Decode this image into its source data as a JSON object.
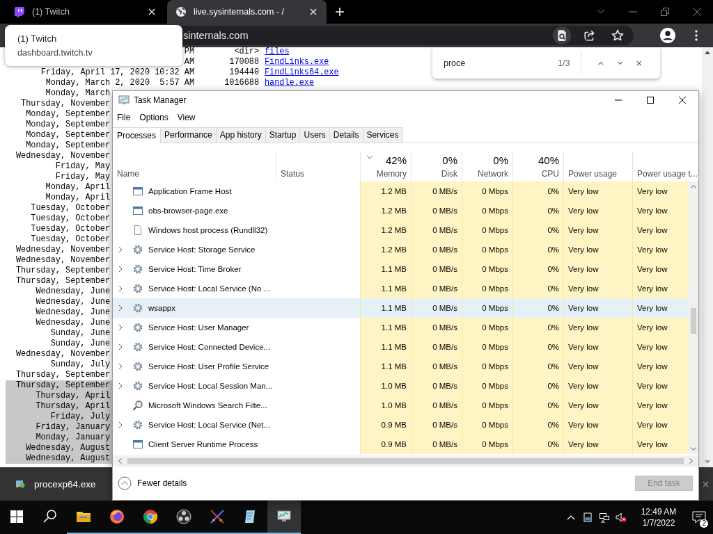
{
  "browser": {
    "tabs": [
      {
        "title": "(1) Twitch",
        "kind": "twitch",
        "selected": false
      },
      {
        "title": "live.sysinternals.com - /",
        "kind": "globe",
        "selected": true
      }
    ],
    "address": "sinternals.com",
    "tab_tooltip": {
      "title": "(1) Twitch",
      "url": "dashboard.twitch.tv"
    },
    "find_bar": {
      "query": "proce",
      "count": "1/3"
    },
    "listing": [
      {
        "time": "PM",
        "size": "<dir>",
        "name": "files",
        "selected": false
      },
      {
        "time": "AM",
        "size": "170088",
        "name": "FindLinks.exe",
        "selected": false
      },
      {
        "date": "Friday, April 17, 2020",
        "time": "10:32 AM",
        "size": "194440",
        "name": "FindLinks64.exe",
        "selected": false
      },
      {
        "date": "Monday, March 2, 2020",
        "time": "5:57 AM",
        "size": "1016688",
        "name": "handle.exe",
        "selected": false
      },
      {
        "date": "Monday, March",
        "selected": false
      },
      {
        "date": "Thursday, November",
        "selected": false
      },
      {
        "date": "Monday, September",
        "selected": false
      },
      {
        "date": "Monday, September",
        "selected": false
      },
      {
        "date": "Monday, September",
        "selected": false
      },
      {
        "date": "Monday, September",
        "selected": false
      },
      {
        "date": "Wednesday, November",
        "selected": false
      },
      {
        "date": "Friday, May",
        "selected": false
      },
      {
        "date": "Friday, May",
        "selected": false
      },
      {
        "date": "Monday, April",
        "selected": false
      },
      {
        "date": "Monday, April",
        "selected": false
      },
      {
        "date": "Tuesday, October",
        "selected": false
      },
      {
        "date": "Tuesday, October",
        "selected": false
      },
      {
        "date": "Tuesday, October",
        "selected": false
      },
      {
        "date": "Tuesday, October",
        "selected": false
      },
      {
        "date": "Wednesday, November",
        "selected": false
      },
      {
        "date": "Wednesday, November",
        "selected": false
      },
      {
        "date": "Thursday, September",
        "selected": false
      },
      {
        "date": "Thursday, September",
        "selected": false
      },
      {
        "date": "Wednesday, June",
        "selected": false
      },
      {
        "date": "Wednesday, June",
        "selected": false
      },
      {
        "date": "Wednesday, June",
        "selected": false
      },
      {
        "date": "Wednesday, June",
        "selected": false
      },
      {
        "date": "Sunday, June",
        "selected": false
      },
      {
        "date": "Sunday, June",
        "selected": false
      },
      {
        "date": "Wednesday, November",
        "selected": false
      },
      {
        "date": "Sunday, July",
        "selected": false
      },
      {
        "date": "Thursday, September",
        "selected": false
      },
      {
        "date": "Thursday, September",
        "selected": true
      },
      {
        "date": "Thursday, April",
        "selected": true
      },
      {
        "date": "Thursday, April",
        "selected": true
      },
      {
        "date": "Friday, July",
        "selected": true
      },
      {
        "date": "Friday, January",
        "selected": true
      },
      {
        "date": "Monday, January",
        "selected": true
      },
      {
        "date": "Wednesday, August",
        "selected": true
      },
      {
        "date": "Wednesday, August",
        "selected": true
      }
    ],
    "download": {
      "file": "procexp64.exe"
    }
  },
  "task_manager": {
    "title": "Task Manager",
    "menu": [
      "File",
      "Options",
      "View"
    ],
    "tabs": [
      {
        "label": "Processes",
        "selected": true
      },
      {
        "label": "Performance",
        "selected": false
      },
      {
        "label": "App history",
        "selected": false
      },
      {
        "label": "Startup",
        "selected": false
      },
      {
        "label": "Users",
        "selected": false
      },
      {
        "label": "Details",
        "selected": false
      },
      {
        "label": "Services",
        "selected": false
      }
    ],
    "columns": [
      {
        "label": "Name",
        "kind": "text"
      },
      {
        "label": "Status",
        "kind": "text"
      },
      {
        "label": "Memory",
        "percent": "42%",
        "sorted": true,
        "kind": "number"
      },
      {
        "label": "Disk",
        "percent": "0%",
        "sorted": false,
        "kind": "number"
      },
      {
        "label": "Network",
        "percent": "0%",
        "sorted": false,
        "kind": "number"
      },
      {
        "label": "CPU",
        "percent": "40%",
        "sorted": false,
        "kind": "number"
      },
      {
        "label": "Power usage",
        "kind": "rating"
      },
      {
        "label": "Power usage t...",
        "kind": "rating"
      }
    ],
    "processes": [
      {
        "name": "Application Frame Host",
        "kind": "app",
        "expandable": false,
        "selected": false,
        "memory": "1.2 MB",
        "disk": "0 MB/s",
        "network": "0 Mbps",
        "cpu": "0%",
        "power": "Very low",
        "power_trend": "Very low"
      },
      {
        "name": "obs-browser-page.exe",
        "kind": "app",
        "expandable": false,
        "selected": false,
        "memory": "1.2 MB",
        "disk": "0 MB/s",
        "network": "0 Mbps",
        "cpu": "0%",
        "power": "Very low",
        "power_trend": "Very low"
      },
      {
        "name": "Windows host process (Rundll32)",
        "kind": "document",
        "expandable": false,
        "selected": false,
        "memory": "1.2 MB",
        "disk": "0 MB/s",
        "network": "0 Mbps",
        "cpu": "0%",
        "power": "Very low",
        "power_trend": "Very low"
      },
      {
        "name": "Service Host: Storage Service",
        "kind": "service",
        "expandable": true,
        "selected": false,
        "memory": "1.2 MB",
        "disk": "0 MB/s",
        "network": "0 Mbps",
        "cpu": "0%",
        "power": "Very low",
        "power_trend": "Very low"
      },
      {
        "name": "Service Host: Time Broker",
        "kind": "service",
        "expandable": true,
        "selected": false,
        "memory": "1.1 MB",
        "disk": "0 MB/s",
        "network": "0 Mbps",
        "cpu": "0%",
        "power": "Very low",
        "power_trend": "Very low"
      },
      {
        "name": "Service Host: Local Service (No ...",
        "kind": "service",
        "expandable": true,
        "selected": false,
        "memory": "1.1 MB",
        "disk": "0 MB/s",
        "network": "0 Mbps",
        "cpu": "0%",
        "power": "Very low",
        "power_trend": "Very low"
      },
      {
        "name": "wsappx",
        "kind": "service",
        "expandable": true,
        "selected": true,
        "memory": "1.1 MB",
        "disk": "0 MB/s",
        "network": "0 Mbps",
        "cpu": "0%",
        "power": "Very low",
        "power_trend": "Very low"
      },
      {
        "name": "Service Host: User Manager",
        "kind": "service",
        "expandable": true,
        "selected": false,
        "memory": "1.1 MB",
        "disk": "0 MB/s",
        "network": "0 Mbps",
        "cpu": "0%",
        "power": "Very low",
        "power_trend": "Very low"
      },
      {
        "name": "Service Host: Connected Device...",
        "kind": "service",
        "expandable": true,
        "selected": false,
        "memory": "1.1 MB",
        "disk": "0 MB/s",
        "network": "0 Mbps",
        "cpu": "0%",
        "power": "Very low",
        "power_trend": "Very low"
      },
      {
        "name": "Service Host: User Profile Service",
        "kind": "service",
        "expandable": true,
        "selected": false,
        "memory": "1.1 MB",
        "disk": "0 MB/s",
        "network": "0 Mbps",
        "cpu": "0%",
        "power": "Very low",
        "power_trend": "Very low"
      },
      {
        "name": "Service Host: Local Session Man...",
        "kind": "service",
        "expandable": true,
        "selected": false,
        "memory": "1.0 MB",
        "disk": "0 MB/s",
        "network": "0 Mbps",
        "cpu": "0%",
        "power": "Very low",
        "power_trend": "Very low"
      },
      {
        "name": "Microsoft Windows Search Filte...",
        "kind": "search",
        "expandable": false,
        "selected": false,
        "memory": "1.0 MB",
        "disk": "0 MB/s",
        "network": "0 Mbps",
        "cpu": "0%",
        "power": "Very low",
        "power_trend": "Very low"
      },
      {
        "name": "Service Host: Local Service (Net...",
        "kind": "service",
        "expandable": true,
        "selected": false,
        "memory": "0.9 MB",
        "disk": "0 MB/s",
        "network": "0 Mbps",
        "cpu": "0%",
        "power": "Very low",
        "power_trend": "Very low"
      },
      {
        "name": "Client Server Runtime Process",
        "kind": "app",
        "expandable": false,
        "selected": false,
        "memory": "0.9 MB",
        "disk": "0 MB/s",
        "network": "0 Mbps",
        "cpu": "0%",
        "power": "Very low",
        "power_trend": "Very low"
      }
    ],
    "fewer_details": "Fewer details",
    "end_task": {
      "label": "End task",
      "disabled": true
    }
  },
  "taskbar": {
    "apps": [
      {
        "kind": "start",
        "running": false,
        "active": false
      },
      {
        "kind": "search",
        "running": false,
        "active": false
      },
      {
        "kind": "folder",
        "running": true,
        "active": false
      },
      {
        "kind": "firefox",
        "running": true,
        "active": false
      },
      {
        "kind": "chrome",
        "running": true,
        "active": false
      },
      {
        "kind": "obs",
        "running": true,
        "active": false
      },
      {
        "kind": "swords",
        "running": true,
        "active": false
      },
      {
        "kind": "notepad",
        "running": true,
        "active": false
      },
      {
        "kind": "taskmanager",
        "running": true,
        "active": true
      }
    ],
    "tray": [
      {
        "kind": "caret"
      },
      {
        "kind": "battery"
      },
      {
        "kind": "network"
      },
      {
        "kind": "muted"
      }
    ],
    "clock": {
      "time": "12:49 AM",
      "date": "1/7/2022"
    },
    "notifications": "2"
  }
}
